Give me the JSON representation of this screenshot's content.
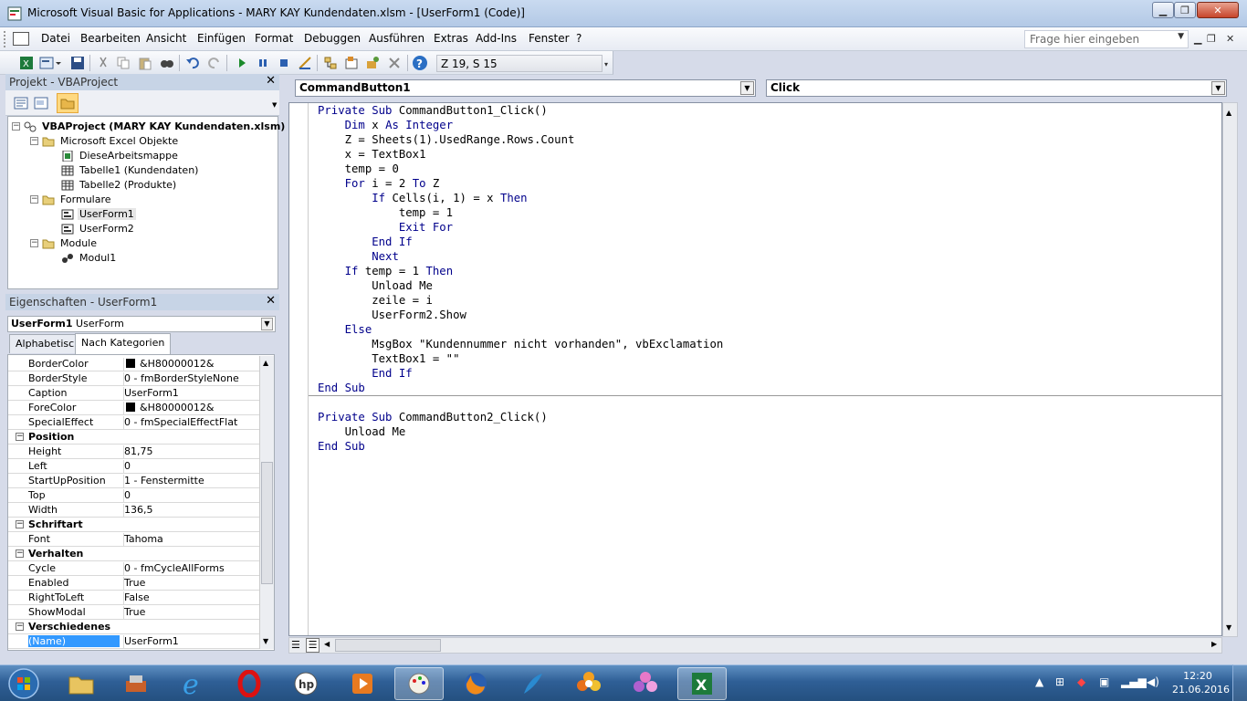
{
  "window": {
    "title": "Microsoft Visual Basic for Applications - MARY KAY Kundendaten.xlsm - [UserForm1 (Code)]"
  },
  "menu": {
    "items": [
      "Datei",
      "Bearbeiten",
      "Ansicht",
      "Einfügen",
      "Format",
      "Debuggen",
      "Ausführen",
      "Extras",
      "Add-Ins",
      "Fenster",
      "?"
    ],
    "help_placeholder": "Frage hier eingeben"
  },
  "toolbar": {
    "position": "Z 19, S 15"
  },
  "project": {
    "title": "Projekt - VBAProject",
    "tree": {
      "root": "VBAProject (MARY KAY Kundendaten.xlsm)",
      "excel_objects": "Microsoft Excel Objekte",
      "workbook": "DieseArbeitsmappe",
      "sheet1": "Tabelle1 (Kundendaten)",
      "sheet2": "Tabelle2 (Produkte)",
      "forms": "Formulare",
      "form1": "UserForm1",
      "form2": "UserForm2",
      "modules": "Module",
      "module1": "Modul1"
    }
  },
  "properties": {
    "title": "Eigenschaften - UserForm1",
    "object_name": "UserForm1",
    "object_type": "UserForm",
    "tabs": [
      "Alphabetisch",
      "Nach Kategorien"
    ],
    "rows": [
      {
        "name": "BorderColor",
        "value": "&H80000012&",
        "swatch": "#000000"
      },
      {
        "name": "BorderStyle",
        "value": "0 - fmBorderStyleNone"
      },
      {
        "name": "Caption",
        "value": "UserForm1"
      },
      {
        "name": "ForeColor",
        "value": "&H80000012&",
        "swatch": "#000000"
      },
      {
        "name": "SpecialEffect",
        "value": "0 - fmSpecialEffectFlat"
      },
      {
        "category": "Position"
      },
      {
        "name": "Height",
        "value": "81,75"
      },
      {
        "name": "Left",
        "value": "0"
      },
      {
        "name": "StartUpPosition",
        "value": "1 - Fenstermitte"
      },
      {
        "name": "Top",
        "value": "0"
      },
      {
        "name": "Width",
        "value": "136,5"
      },
      {
        "category": "Schriftart"
      },
      {
        "name": "Font",
        "value": "Tahoma"
      },
      {
        "category": "Verhalten"
      },
      {
        "name": "Cycle",
        "value": "0 - fmCycleAllForms"
      },
      {
        "name": "Enabled",
        "value": "True"
      },
      {
        "name": "RightToLeft",
        "value": "False"
      },
      {
        "name": "ShowModal",
        "value": "True"
      },
      {
        "category": "Verschiedenes"
      },
      {
        "name": "(Name)",
        "value": "UserForm1",
        "selected": true
      }
    ]
  },
  "code": {
    "object_combo": "CommandButton1",
    "proc_combo": "Click",
    "lines": [
      "Private Sub CommandButton1_Click()",
      "    Dim x As Integer",
      "    Z = Sheets(1).UsedRange.Rows.Count",
      "    x = TextBox1",
      "    temp = 0",
      "    For i = 2 To Z",
      "        If Cells(i, 1) = x Then",
      "            temp = 1",
      "            Exit For",
      "        End If",
      "        Next",
      "    If temp = 1 Then",
      "        Unload Me",
      "        zeile = i",
      "        UserForm2.Show",
      "    Else",
      "        MsgBox \"Kundennummer nicht vorhanden\", vbExclamation",
      "        TextBox1 = \"\"",
      "        End If",
      "End Sub",
      "",
      "Private Sub CommandButton2_Click()",
      "    Unload Me",
      "End Sub"
    ]
  },
  "taskbar": {
    "time": "12:20",
    "date": "21.06.2016",
    "apps": [
      "start-orb",
      "explorer",
      "hp-tool",
      "internet-explorer",
      "opera",
      "hp",
      "media-player",
      "paint",
      "firefox",
      "feather",
      "flower-orange",
      "flower-pink",
      "excel"
    ]
  }
}
